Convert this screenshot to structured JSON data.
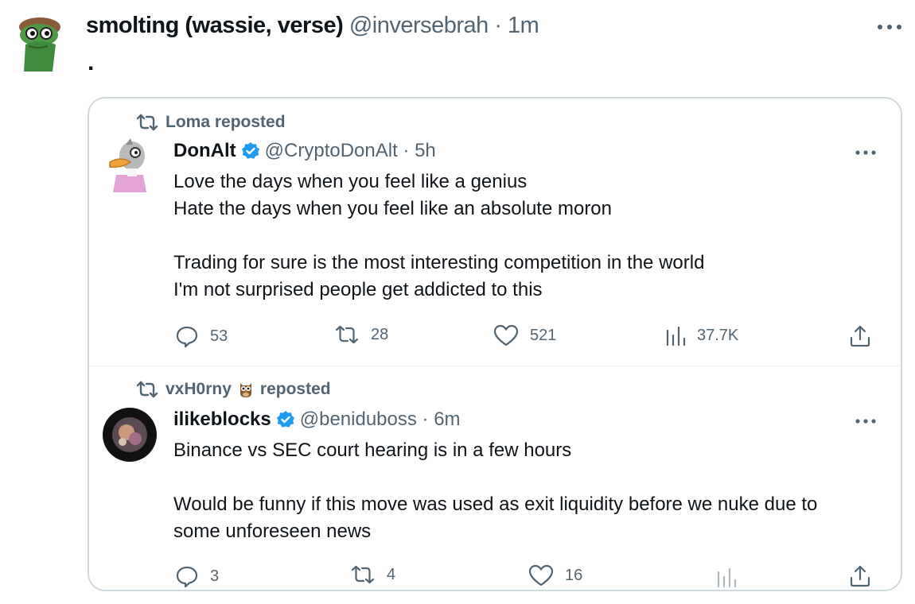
{
  "outer_tweet": {
    "display_name": "smolting (wassie, verse)",
    "handle_time": "@inversebrah · 1m",
    "text": "."
  },
  "tweets": [
    {
      "repost_label": "Loma reposted",
      "display_name": "DonAlt",
      "handle_time": "@CryptoDonAlt · 5h",
      "verified": true,
      "lines": [
        "Love the days when you feel like a genius",
        "Hate the days when you feel like an absolute moron",
        "",
        "Trading for sure is the most interesting competition in the world",
        "I'm not surprised people get addicted to this"
      ],
      "replies": "53",
      "reposts": "28",
      "likes": "521",
      "views": "37.7K"
    },
    {
      "repost_user": "vxH0rny",
      "repost_label": "reposted",
      "display_name": "ilikeblocks",
      "handle_time": "@beniduboss · 6m",
      "verified": true,
      "lines": [
        "Binance vs SEC court hearing is in a few hours",
        "",
        "Would be funny if this move was used as exit liquidity before we nuke due to",
        "some unforeseen news"
      ],
      "replies": "3",
      "reposts": "4",
      "likes": "16"
    }
  ],
  "colors": {
    "text_primary": "#0f1419",
    "text_secondary": "#536471",
    "verified_blue": "#1d9bf0",
    "border": "#cfd9de"
  },
  "icons": [
    "more-icon",
    "repost-icon",
    "verified-badge-icon",
    "reply-icon",
    "like-icon",
    "views-icon",
    "share-icon",
    "owl-emoji-icon"
  ]
}
